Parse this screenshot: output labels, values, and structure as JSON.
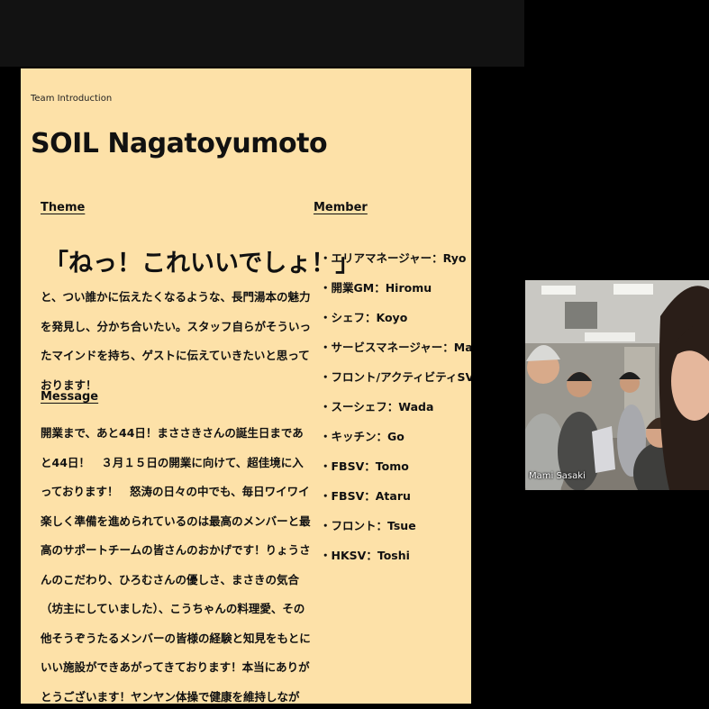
{
  "slide": {
    "eyebrow": "Team Introduction",
    "title": "SOIL Nagatoyumoto",
    "theme": {
      "label": "Theme",
      "catch": "「ねっ！これいいでしょ！」",
      "body": "と、つい誰かに伝えたくなるような、長門湯本の魅力を発見し、分かち合いたい。スタッフ自らがそういったマインドを持ち、ゲストに伝えていきたいと思っております！"
    },
    "message": {
      "label": "Message",
      "body": "開業まで、あと44日！まささきさんの誕生日まであと44日！　３月１５日の開業に向けて、超佳境に入っております！　怒涛の日々の中でも、毎日ワイワイ楽しく準備を進められているのは最高のメンバーと最高のサポートチームの皆さんのおかげです！りょうさんのこだわり、ひろむさんの優しさ、まさきの気合（坊主にしていました）、こうちゃんの料理愛、その他そうぞうたるメンバーの皆様の経験と知見をもとにいい施設ができあがってきております！本当にありがとうございます！ヤンヤン体操で健康を維持しながら、笑顔で走り切りましょう！！"
    },
    "member": {
      "label": "Member",
      "items": [
        "・エリアマネージャー：Ryo",
        "・開業GM：Hiromu",
        "・シェフ：Koyo",
        "・サービスマネージャー：Mami",
        "・フロント/アクティビティSV：Masaki",
        "・スーシェフ：Wada",
        "・キッチン：Go",
        "・FBSV：Tomo",
        "・FBSV：Ataru",
        "・フロント：Tsue",
        "・HKSV：Toshi"
      ]
    }
  },
  "video": {
    "participant_name": "Mami Sasaki"
  },
  "colors": {
    "slide_background": "#fde1a8",
    "screen_background": "#000000",
    "top_bar": "#121212"
  }
}
